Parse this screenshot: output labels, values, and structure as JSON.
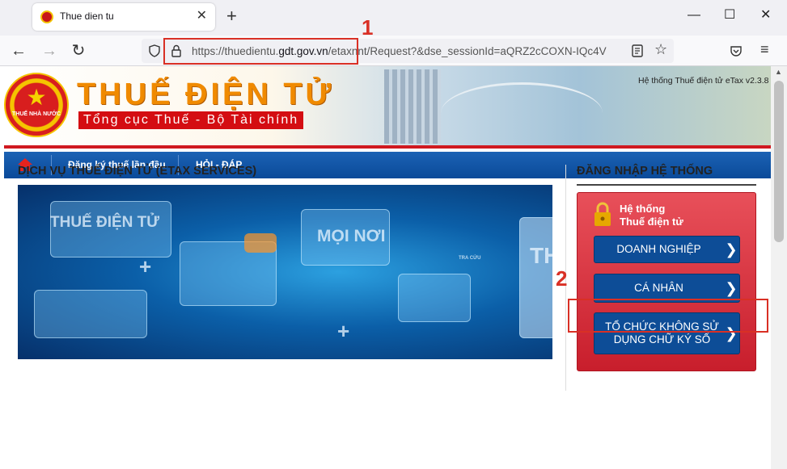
{
  "browser": {
    "tab_title": "Thue dien tu",
    "tab_close": "✕",
    "new_tab": "+",
    "url_prefix": "https://thuedientu.",
    "url_domain": "gdt.gov.vn",
    "url_path": "/etaxnnt/Request?&dse_sessionId=aQRZ2cCOXN-IQc4V",
    "annotation_1": "1",
    "annotation_2": "2"
  },
  "banner": {
    "emblem_star": "★",
    "emblem_text": "THUẾ NHÀ NƯỚC",
    "title": "THUẾ ĐIỆN TỬ",
    "subtitle": "Tổng cục Thuế - Bộ Tài chính",
    "version": "Hệ thống Thuế điện tử eTax v2.3.8"
  },
  "menu": {
    "items": [
      "Đăng ký thuế lần đầu",
      "HỎI - ĐÁP"
    ]
  },
  "services": {
    "title": "DỊCH VỤ THUẾ ĐIỆN TỬ (ETAX SERVICES)",
    "hero_text_1": "THUẾ ĐIỆN TỬ",
    "hero_text_2": "MỌI NƠI",
    "hero_text_3": "TH",
    "hero_text_4": "TRA CỨU"
  },
  "login": {
    "title": "ĐĂNG NHẬP HỆ THỐNG",
    "head_line1": "Hệ thống",
    "head_line2": "Thuế điện tử",
    "buttons": [
      {
        "label": "DOANH NGHIỆP"
      },
      {
        "label": "CÁ NHÂN"
      },
      {
        "label": "TỔ CHỨC KHÔNG SỬ DỤNG CHỮ KÝ SỐ"
      }
    ],
    "chevron": "❯"
  },
  "colors": {
    "accent_red": "#d93025",
    "menu_blue": "#0a4a99",
    "login_red": "#c81e2c"
  }
}
